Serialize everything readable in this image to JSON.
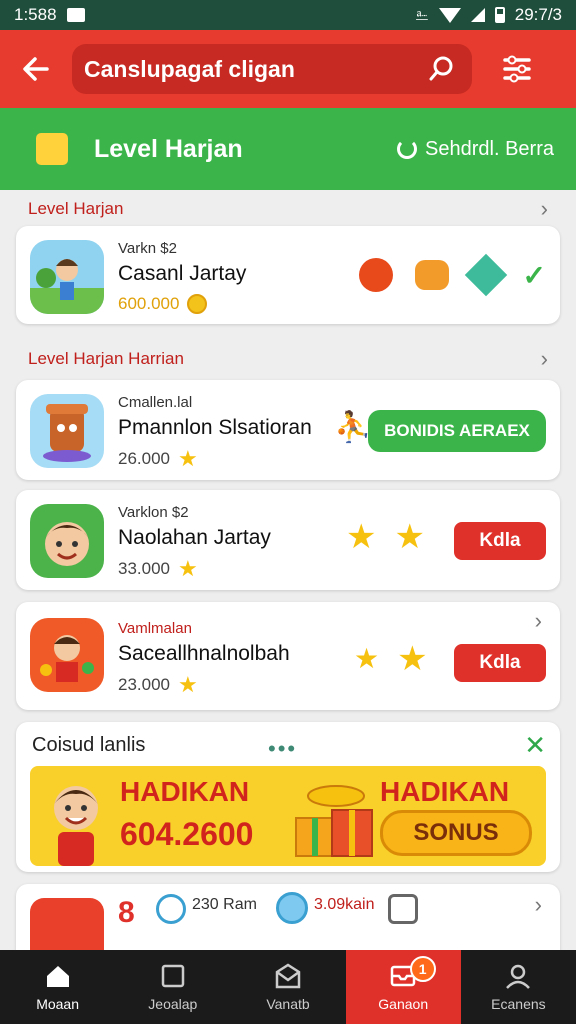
{
  "status": {
    "time_left": "1:588",
    "time_right": "29:7/3"
  },
  "search": {
    "query": "Canslupagaf cligan"
  },
  "header": {
    "title": "Level Harjan",
    "right_label": "Sehdrdl. Berra"
  },
  "sections": [
    {
      "title": "Level Harjan"
    },
    {
      "title": "Level Harjan Harrian"
    }
  ],
  "cards": [
    {
      "small": "Varkn $2",
      "name": "Casanl Jartay",
      "points": "600.000"
    },
    {
      "small": "Cmallen.lal",
      "name": "Pmannlon Slsatioran",
      "points": "26.000",
      "button": "BONIDIS AERAEX"
    },
    {
      "small": "Varklon $2",
      "name": "Naolahan Jartay",
      "points": "33.000",
      "button": "Kdla"
    },
    {
      "small": "Vamlmalan",
      "name": "Saceallhnalnolbah",
      "points": "23.000",
      "button": "Kdla"
    }
  ],
  "promo": {
    "header": "Coisud lanlis",
    "title_left": "HADIKAN",
    "value": "604.2600",
    "title_right": "HADIKAN",
    "bonus_label": "SONUS"
  },
  "bottom_card": {
    "stat1": "230 Ram",
    "stat2": "3.09kain"
  },
  "nav": {
    "items": [
      {
        "label": "Moaan"
      },
      {
        "label": "Jeoalap"
      },
      {
        "label": "Vanatb"
      },
      {
        "label": "Ganaon"
      },
      {
        "label": "Ecanens"
      }
    ],
    "badge": "1"
  },
  "colors": {
    "red": "#e63b2e",
    "green": "#3bb54a",
    "yellow": "#f9cf2a",
    "dark": "#1b1b1b"
  }
}
